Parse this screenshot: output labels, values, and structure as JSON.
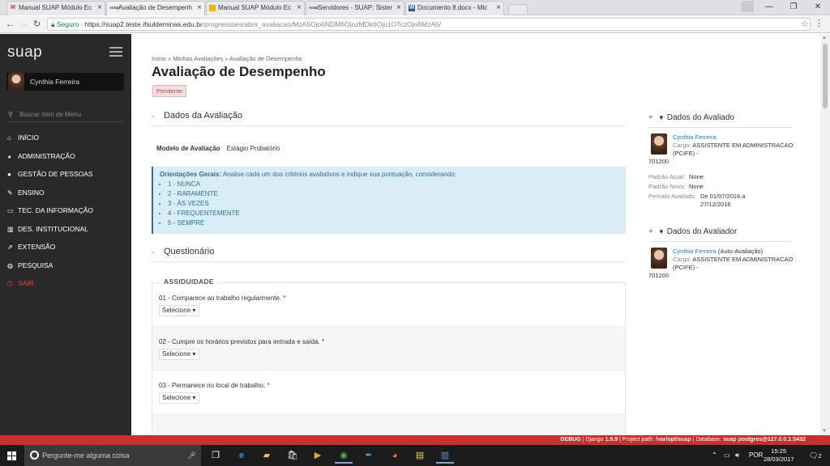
{
  "browser": {
    "tabs": [
      {
        "icon": "gmail-icon",
        "label": "Manual SUAP Módulo Ec",
        "color": "#d93025"
      },
      {
        "icon": "suap-icon",
        "label": "Avaliação de Desempenh",
        "active": true,
        "color": "#555"
      },
      {
        "icon": "drive-icon",
        "label": "Manual SUAP Módulo Ec",
        "color": "#f4b400"
      },
      {
        "icon": "suap-icon",
        "label": "Servidores - SUAP: Sister",
        "color": "#555"
      },
      {
        "icon": "word-icon",
        "label": "Documento 8.docx - Mic",
        "color": "#2b579a"
      }
    ],
    "secure_label": "Seguro",
    "url_host": "https://suap2.teste.ifsuldeminas.edu.br",
    "url_path": "/progressoes/abrir_avaliacao/MzA5Ojo6NDM6OjozMDk6Ojo1OTczOjo6MzA5/"
  },
  "sidebar": {
    "logo": "suap",
    "user_name": "Cynthia Ferreira",
    "search_placeholder": "Buscar Item de Menu",
    "items": [
      {
        "icon": "home-icon",
        "glyph": "⌂",
        "label": "INÍCIO"
      },
      {
        "icon": "pie-chart-icon",
        "glyph": "◕",
        "label": "ADMINISTRAÇÃO"
      },
      {
        "icon": "user-icon",
        "glyph": "●",
        "label": "GESTÃO DE PESSOAS"
      },
      {
        "icon": "pencil-icon",
        "glyph": "✎",
        "label": "ENSINO"
      },
      {
        "icon": "monitor-icon",
        "glyph": "▭",
        "label": "TEC. DA INFORMAÇÃO"
      },
      {
        "icon": "bar-chart-icon",
        "glyph": "▥",
        "label": "DES. INSTITUCIONAL"
      },
      {
        "icon": "external-link-icon",
        "glyph": "⇗",
        "label": "EXTENSÃO"
      },
      {
        "icon": "globe-icon",
        "glyph": "◍",
        "label": "PESQUISA"
      },
      {
        "icon": "power-icon",
        "glyph": "⏻",
        "label": "SAIR"
      }
    ]
  },
  "page": {
    "breadcrumb": "Início » Minhas Avaliações » Avaliação de Desempenho",
    "title": "Avaliação de Desempenho",
    "status": "Pendente",
    "section_dados": "Dados da Avaliação",
    "modelo_label": "Modelo de Avaliação",
    "modelo_value": "Estágio Probatório",
    "orientacoes_label": "Orientações Gerais:",
    "orientacoes_text": "Analise cada um dos critérios avaliativos e indique sua pontuação, considerando:",
    "scale": [
      "1 - NUNCA",
      "2 - RARAMENTE",
      "3 - ÀS VEZES",
      "4 - FREQUENTEMENTE",
      "5 - SEMPRE"
    ],
    "section_questionario": "Questionário",
    "group_title": "ASSIDUIDADE",
    "questions": [
      {
        "text": "01 - Comparece ao trabalho regularmente.",
        "select": "Selecione"
      },
      {
        "text": "02 - Cumpre os horários previstos para entrada e saída.",
        "select": "Selecione"
      },
      {
        "text": "03 - Permanece no local de trabalho.",
        "select": "Selecione"
      }
    ]
  },
  "avaliado": {
    "header": "Dados do Avaliado",
    "name": "Cynthia Ferreira",
    "cargo_label": "Cargo:",
    "cargo": "ASSISTENTE EM ADMINISTRACAO (PCIFE) -",
    "cargo_code": "701200",
    "padrao_atual_label": "Padrão Atual:",
    "padrao_atual": "None",
    "padrao_novo_label": "Padrão Novo:",
    "padrao_novo": "None",
    "periodo_label": "Período Avaliado:",
    "periodo": "De 01/07/2016 a 27/12/2016"
  },
  "avaliador": {
    "header": "Dados do Avaliador",
    "name": "Cynthia Ferreira",
    "note": "(Auto-Avaliação)",
    "cargo_label": "Cargo:",
    "cargo": "ASSISTENTE EM ADMINISTRACAO (PCIFE) -",
    "cargo_code": "701200"
  },
  "debug": {
    "prefix": "DEBUG",
    "django_label": "| Django",
    "django_version": "1.9.9",
    "project_label": "| Project path:",
    "project_path": "/var/opt/suap",
    "db_label": "| Database:",
    "db_value": "suap postgres@127.0.0.1:5432"
  },
  "taskbar": {
    "search_placeholder": "Pergunte-me alguma coisa",
    "language": "POR",
    "time": "15:25",
    "date": "28/03/2017",
    "notifications": "2"
  },
  "colors": {
    "sidebar_bg": "#292929",
    "alert_bg": "#d9edf7",
    "debug_bg": "#c9302c",
    "link": "#2a7bb0"
  }
}
